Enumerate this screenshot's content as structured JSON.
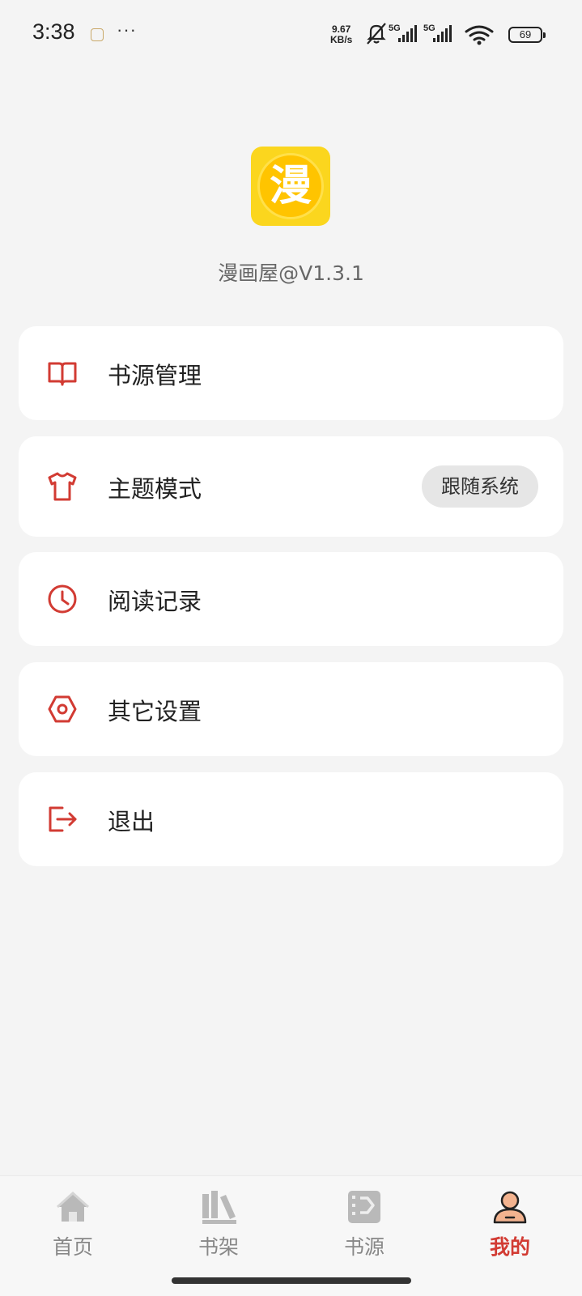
{
  "status_bar": {
    "time": "3:38",
    "dots": "···",
    "net_speed_value": "9.67",
    "net_speed_unit": "KB/s",
    "signal_1": "5G",
    "signal_2": "5G",
    "battery": "69"
  },
  "header": {
    "logo_char": "漫",
    "app_version": "漫画屋@V1.3.1"
  },
  "menu": [
    {
      "label": "书源管理",
      "icon": "book-open-icon"
    },
    {
      "label": "主题模式",
      "icon": "tshirt-icon",
      "value": "跟随系统"
    },
    {
      "label": "阅读记录",
      "icon": "clock-icon"
    },
    {
      "label": "其它设置",
      "icon": "hex-nut-icon"
    },
    {
      "label": "退出",
      "icon": "logout-icon"
    }
  ],
  "bottom_nav": [
    {
      "label": "首页",
      "icon": "home-icon"
    },
    {
      "label": "书架",
      "icon": "bookshelf-icon"
    },
    {
      "label": "书源",
      "icon": "source-icon"
    },
    {
      "label": "我的",
      "icon": "user-icon",
      "active": true
    }
  ],
  "colors": {
    "accent": "#d23b33",
    "background": "#f4f4f4",
    "card": "#ffffff",
    "logo_yellow": "#fbd61e"
  }
}
